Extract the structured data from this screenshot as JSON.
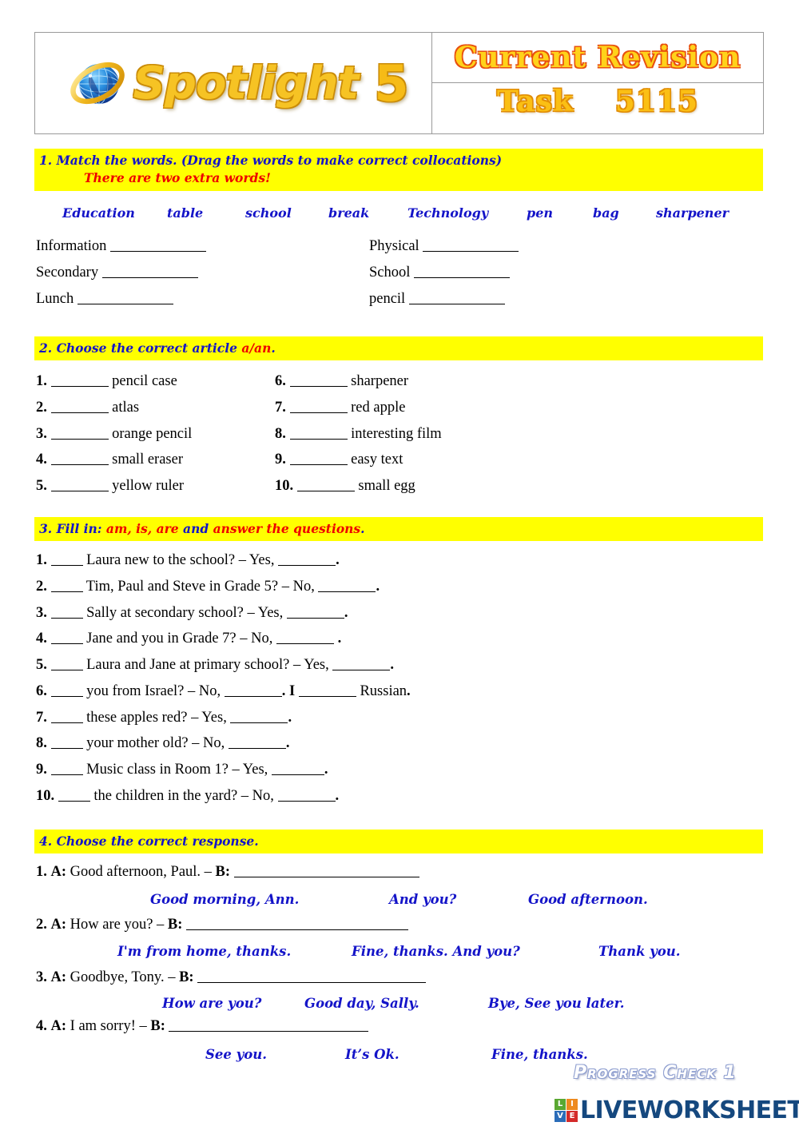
{
  "header": {
    "logo_icon": "globe-icon",
    "brand": "Spotlight",
    "level": "5",
    "title_line1": "Current Revision",
    "task_label": "Task",
    "task_number": "5115"
  },
  "colors": {
    "highlight": "#ffff00",
    "heading_blue": "#1414c8",
    "heading_red": "#ee0000",
    "gold": "#fbbf14",
    "orange_outline": "#e8500e",
    "logo_blue": "#15487e"
  },
  "section1": {
    "heading_main": "1. Match the words. (Drag the words to make correct collocations)",
    "heading_sub": "There are two extra words!",
    "word_bank": [
      "Education",
      "table",
      "school",
      "break",
      "Technology",
      "pen",
      "bag",
      "sharpener"
    ],
    "left_items": [
      "Information",
      "Secondary",
      "Lunch"
    ],
    "right_items": [
      "Physical",
      "School",
      "pencil"
    ]
  },
  "section2": {
    "heading_pre": "2. Choose the correct article ",
    "heading_red": "a/an",
    "heading_post": ".",
    "left_items": [
      {
        "num": "1.",
        "text": "pencil case"
      },
      {
        "num": "2.",
        "text": "atlas"
      },
      {
        "num": "3.",
        "text": "orange pencil"
      },
      {
        "num": "4.",
        "text": "small eraser"
      },
      {
        "num": "5.",
        "text": "yellow ruler"
      }
    ],
    "right_items": [
      {
        "num": "6.",
        "text": "sharpener"
      },
      {
        "num": "7.",
        "text": "red apple"
      },
      {
        "num": "8.",
        "text": "interesting film"
      },
      {
        "num": "9.",
        "text": "easy text"
      },
      {
        "num": "10.",
        "text": "small egg"
      }
    ]
  },
  "section3": {
    "heading_p1": "3. Fill in: ",
    "heading_p2": "am, is, are",
    "heading_p3": " and ",
    "heading_p4": "answer the questions",
    "heading_p5": ".",
    "items": [
      {
        "num": "1.",
        "question": "Laura new to the school? – Yes,",
        "tail": "."
      },
      {
        "num": "2.",
        "question": "Tim, Paul and Steve in Grade 5? – No,",
        "tail": "."
      },
      {
        "num": "3.",
        "question": "Sally at secondary school? – Yes,",
        "tail": "."
      },
      {
        "num": "4.",
        "question": "Jane and you in Grade 7? – No,",
        "tail": " ."
      },
      {
        "num": "5.",
        "question": "Laura and Jane at primary school? – Yes,",
        "tail": "."
      },
      {
        "num": "6.",
        "question": "you from Israel? – No,",
        "tail": ". I",
        "tail2": "Russian",
        "tail3": "."
      },
      {
        "num": "7.",
        "question": "these apples red? – Yes,",
        "tail": "."
      },
      {
        "num": "8.",
        "question": "your mother old? – No,",
        "tail": "."
      },
      {
        "num": "9.",
        "question": "Music class in Room 1? – Yes,",
        "tail": "."
      },
      {
        "num": "10.",
        "question": "the children in the yard? – No,",
        "tail": "."
      }
    ]
  },
  "section4": {
    "heading": "4. Choose the correct response.",
    "items": [
      {
        "num": "1.",
        "a_label": "A:",
        "prompt": "Good afternoon, Paul. –",
        "b_label": "B:",
        "options": [
          "Good morning, Ann.",
          "And you?",
          "Good afternoon."
        ]
      },
      {
        "num": "2.",
        "a_label": "A:",
        "prompt": "How are you? –",
        "b_label": "B:",
        "options": [
          "I'm from home, thanks.",
          "Fine, thanks. And you?",
          "Thank you."
        ]
      },
      {
        "num": "3.",
        "a_label": "A:",
        "prompt": "Goodbye, Tony. –",
        "b_label": "B:",
        "options": [
          "How are you?",
          "Good day, Sally.",
          "Bye, See you later."
        ]
      },
      {
        "num": "4.",
        "a_label": "A:",
        "prompt": "I am sorry! –",
        "b_label": "B:",
        "options": [
          "See you.",
          "It’s Ok.",
          "Fine, thanks."
        ]
      }
    ]
  },
  "footer": {
    "progress_check": "Progress Check 1",
    "logo_squares": [
      "L",
      "I",
      "V",
      "E"
    ],
    "logo_word": "LIVEWORKSHEETS"
  }
}
